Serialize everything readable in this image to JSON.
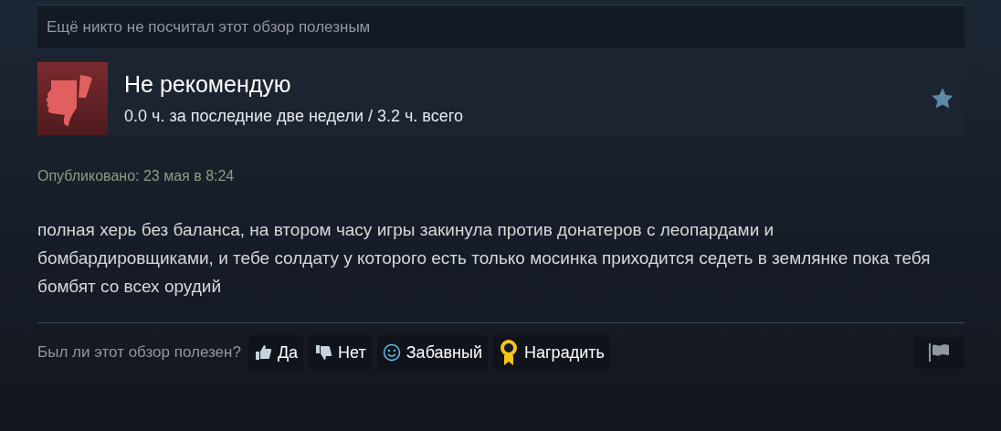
{
  "helpful_summary": "Ещё никто не посчитал этот обзор полезным",
  "review": {
    "verdict": "Не рекомендую",
    "hours": "0.0 ч. за последние две недели / 3.2 ч. всего"
  },
  "posted": "Опубликовано: 23 мая в 8:24",
  "text": "полная херь без баланса, на втором часу игры закинула против донатеров с леопардами и бомбардировщиками, и тебе солдату у которого есть только мосинка приходится седеть в землянке пока тебя бомбят со всех орудий",
  "feedback": {
    "question": "Был ли этот обзор полезен?",
    "buttons": [
      {
        "kind": "yes",
        "label": "Да"
      },
      {
        "kind": "no",
        "label": "Нет"
      },
      {
        "kind": "funny",
        "label": "Забавный"
      },
      {
        "kind": "award",
        "label": "Наградить"
      }
    ]
  }
}
